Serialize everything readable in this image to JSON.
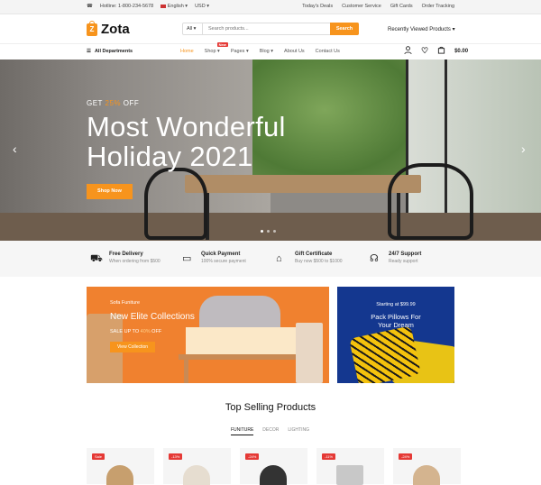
{
  "topbar": {
    "hotline": "Hotline: 1-800-234-5678",
    "language": "English",
    "currency": "USD",
    "links": [
      "Today's Deals",
      "Customer Service",
      "Gift Cards",
      "Order Tracking"
    ]
  },
  "header": {
    "logo_letter": "Z",
    "logo_text": "Zota",
    "search_category": "All",
    "search_placeholder": "Search products...",
    "search_button": "Search",
    "recently_viewed": "Recently Viewed Products"
  },
  "nav": {
    "departments": "All Departments",
    "menu": [
      "Home",
      "Shop",
      "Pages",
      "Blog",
      "About Us",
      "Contact Us"
    ],
    "new_badge": "New",
    "cart_total": "$0.00"
  },
  "hero": {
    "pre_a": "GET ",
    "pre_b": "25%",
    "pre_c": " OFF",
    "title_line1": "Most Wonderful",
    "title_line2": "Holiday 2021",
    "button": "Shop Now"
  },
  "features": [
    {
      "title": "Free Delivery",
      "sub": "When ordering from $500"
    },
    {
      "title": "Quick Payment",
      "sub": "100% secure payment"
    },
    {
      "title": "Gift Certificate",
      "sub": "Buy now $500 to $1000"
    },
    {
      "title": "24/7 Support",
      "sub": "Ready support"
    }
  ],
  "banner1": {
    "small": "Sofa Funiture",
    "title": "New Elite Collections",
    "offer_a": "SALE UP TO ",
    "offer_b": "40%",
    "offer_c": " OFF",
    "button": "View Collection"
  },
  "banner2": {
    "small": "Starting at $99.99",
    "title_line1": "Pack Pillows For",
    "title_line2": "Your Dream"
  },
  "section": {
    "title": "Top Selling Products",
    "tabs": [
      "FUNITURE",
      "DECOR",
      "LIGHTING"
    ]
  },
  "products": [
    {
      "badge": "Sale"
    },
    {
      "badge": "-13%"
    },
    {
      "badge": "-24%"
    },
    {
      "badge": "-11%"
    },
    {
      "badge": "-24%"
    }
  ],
  "colors": {
    "accent": "#f7941d",
    "banner_orange": "#f0812f",
    "banner_blue": "#14378f"
  }
}
